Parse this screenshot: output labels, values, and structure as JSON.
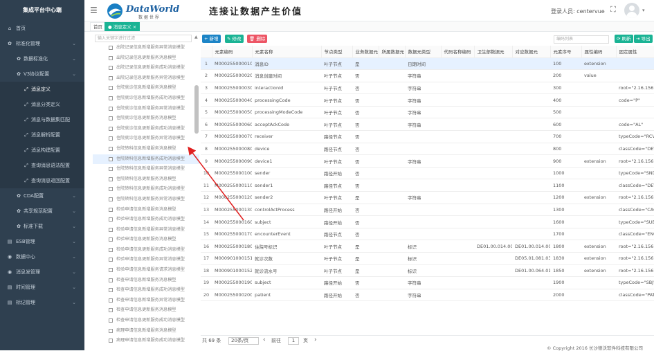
{
  "app_title": "集成平台中心端",
  "sidebar": {
    "items": [
      {
        "label": "首页",
        "icon": "home-icon",
        "glyph": "⌂",
        "level": 1,
        "arrow": ""
      },
      {
        "label": "标准化管理",
        "icon": "wrench-icon",
        "glyph": "✿",
        "level": 1,
        "arrow": "⌄"
      },
      {
        "label": "数据标准化",
        "icon": "gear-icon",
        "glyph": "✿",
        "level": 2,
        "arrow": "⌄"
      },
      {
        "label": "V3协议配置",
        "icon": "gear-icon",
        "glyph": "✿",
        "level": 2,
        "arrow": "⌄"
      },
      {
        "label": "消息定义",
        "icon": "expand-icon",
        "glyph": "⤢",
        "level": 3,
        "arrow": "",
        "active": true
      },
      {
        "label": "消息分类定义",
        "icon": "expand-icon",
        "glyph": "⤢",
        "level": 3,
        "arrow": ""
      },
      {
        "label": "消息与数据集匹配",
        "icon": "expand-icon",
        "glyph": "⤢",
        "level": 3,
        "arrow": ""
      },
      {
        "label": "消息解析配置",
        "icon": "expand-icon",
        "glyph": "⤢",
        "level": 3,
        "arrow": ""
      },
      {
        "label": "消息构建配置",
        "icon": "expand-icon",
        "glyph": "⤢",
        "level": 3,
        "arrow": ""
      },
      {
        "label": "查询消息语法配置",
        "icon": "expand-icon",
        "glyph": "⤢",
        "level": 3,
        "arrow": ""
      },
      {
        "label": "查询消息返回配置",
        "icon": "expand-icon",
        "glyph": "⤢",
        "level": 3,
        "arrow": ""
      },
      {
        "label": "CDA配置",
        "icon": "gear-icon",
        "glyph": "✿",
        "level": 2,
        "arrow": "⌄"
      },
      {
        "label": "共享规范配置",
        "icon": "gear-icon",
        "glyph": "✿",
        "level": 2,
        "arrow": "⌄"
      },
      {
        "label": "标准下载",
        "icon": "gear-icon",
        "glyph": "✿",
        "level": 2,
        "arrow": "⌄"
      },
      {
        "label": "ESB管理",
        "icon": "folder-icon",
        "glyph": "▤",
        "level": 1,
        "arrow": "⌄"
      },
      {
        "label": "数据中心",
        "icon": "globe-icon",
        "glyph": "◉",
        "level": 1,
        "arrow": "⌄"
      },
      {
        "label": "消息发管理",
        "icon": "globe-icon",
        "glyph": "◉",
        "level": 1,
        "arrow": "⌄"
      },
      {
        "label": "时间管理",
        "icon": "folder-icon",
        "glyph": "▤",
        "level": 1,
        "arrow": "⌄"
      },
      {
        "label": "标记管理",
        "icon": "folder-icon",
        "glyph": "▤",
        "level": 1,
        "arrow": "⌄"
      }
    ]
  },
  "header": {
    "logo_text": "DataWorld",
    "logo_sub": "数 据 世 界",
    "slogan": "连接让数据产生价值",
    "login_label": "登录人员:",
    "user": "centervue",
    "caret": "▾",
    "fullscreen_icon": "⛶"
  },
  "tabs": [
    {
      "label": "首页",
      "active": false
    },
    {
      "label": "● 消息定义 ×",
      "active": true
    }
  ],
  "tree": {
    "search_placeholder": "输入关键字进行过滤",
    "selected_index": 11,
    "nodes": [
      "出院记录信息新增服务异常消息模型",
      "出院记录信息更新服务消息模型",
      "出院记录信息更新服务成功消息模型",
      "出院记录信息更新服务异常消息模型",
      "住院就诊信息新增服务消息模型",
      "住院就诊信息新增服务成功消息模型",
      "住院就诊信息新增服务异常消息模型",
      "住院就诊信息更新服务消息模型",
      "住院就诊信息更新服务成功消息模型",
      "住院就诊信息更新服务异常消息模型",
      "住院转科信息新增服务消息模型",
      "住院转科信息新增服务成功消息模型",
      "住院转科信息新增服务异常消息模型",
      "住院转科信息更新服务消息模型",
      "住院转科信息更新服务成功消息模型",
      "住院转科信息更新服务异常消息模型",
      "检验申请信息新增服务消息模型",
      "检验申请信息新增服务成功消息模型",
      "检验申请信息新增服务异常消息模型",
      "检验申请信息更新服务消息模型",
      "检验申请信息更新服务成功消息模型",
      "检验申请信息更新服务异常消息模型",
      "检验申请信息新增服务请求消息模型",
      "检查申请信息新增服务消息模型",
      "检查申请信息新增服务成功消息模型",
      "检查申请信息新增服务异常消息模型",
      "检查申请信息更新服务消息模型",
      "检查申请信息更新服务成功消息模型",
      "病理申请信息新增服务消息模型",
      "病理申请信息新增服务成功消息模型"
    ]
  },
  "toolbar": {
    "add": "+ 新增",
    "edit": "✎ 修改",
    "delete": "🗑 删除",
    "search_placeholder": "编码列表",
    "refresh": "⟳ 刷新",
    "export": "⇥ 导出",
    "colors": {
      "add": "#1c84c6",
      "edit": "#1ab394",
      "delete": "#ed5565",
      "refresh": "#1ab394"
    }
  },
  "table": {
    "columns": [
      "",
      "元素编码",
      "元素名称",
      "节点类型",
      "业务数据元",
      "所属数据元",
      "数据元类型",
      "代码名称编码",
      "卫生部数据元",
      "对应数据元",
      "元素序号",
      "属性编码",
      "固定属性"
    ],
    "rows": [
      [
        "1",
        "M000255000010",
        "消息ID",
        "叶子节点",
        "是",
        "",
        "日期时间",
        "",
        "",
        "",
        "100",
        "extension",
        ""
      ],
      [
        "2",
        "M000255000020",
        "消息创建时间",
        "叶子节点",
        "否",
        "",
        "字符串",
        "",
        "",
        "",
        "200",
        "value",
        ""
      ],
      [
        "3",
        "M000255000030",
        "interactionId",
        "叶子节点",
        "否",
        "",
        "字符串",
        "",
        "",
        "",
        "300",
        "",
        "root=\"2.16.156\""
      ],
      [
        "4",
        "M000255000040",
        "processingCode",
        "叶子节点",
        "否",
        "",
        "字符串",
        "",
        "",
        "",
        "400",
        "",
        "code=\"P\""
      ],
      [
        "5",
        "M000255000050",
        "processingModeCode",
        "叶子节点",
        "否",
        "",
        "字符串",
        "",
        "",
        "",
        "500",
        "",
        ""
      ],
      [
        "6",
        "M000255000060",
        "acceptAckCode",
        "叶子节点",
        "否",
        "",
        "字符串",
        "",
        "",
        "",
        "600",
        "",
        "code=\"AL\""
      ],
      [
        "7",
        "M000255000070",
        "receiver",
        "路径节点",
        "否",
        "",
        "",
        "",
        "",
        "",
        "700",
        "",
        "typeCode=\"RCV\""
      ],
      [
        "8",
        "M000255000080",
        "device",
        "路径节点",
        "否",
        "",
        "",
        "",
        "",
        "",
        "800",
        "",
        "classCode=\"DEV\""
      ],
      [
        "9",
        "M000255000090",
        "device1",
        "叶子节点",
        "否",
        "",
        "字符串",
        "",
        "",
        "",
        "900",
        "extension",
        "root=\"2.16.156\""
      ],
      [
        "10",
        "M000255000100",
        "sender",
        "路径开始",
        "否",
        "",
        "",
        "",
        "",
        "",
        "1000",
        "",
        "typeCode=\"SND\""
      ],
      [
        "11",
        "M000255000110",
        "sender1",
        "路径节点",
        "否",
        "",
        "",
        "",
        "",
        "",
        "1100",
        "",
        "classCode=\"DEV\""
      ],
      [
        "12",
        "M000255000120",
        "sender2",
        "叶子节点",
        "是",
        "",
        "字符串",
        "",
        "",
        "",
        "1200",
        "extension",
        "root=\"2.16.156\""
      ],
      [
        "13",
        "M000255000130",
        "controlActProcess",
        "路径开始",
        "否",
        "",
        "",
        "",
        "",
        "",
        "1300",
        "",
        "classCode=\"CACT\""
      ],
      [
        "14",
        "M000255000160",
        "subject",
        "路径开始",
        "否",
        "",
        "",
        "",
        "",
        "",
        "1600",
        "",
        "typeCode=\"SUBJ\""
      ],
      [
        "15",
        "M000255000170",
        "encounterEvent",
        "路径节点",
        "否",
        "",
        "",
        "",
        "",
        "",
        "1700",
        "",
        "classCode=\"ENC\""
      ],
      [
        "16",
        "M000255000180",
        "住院号标识",
        "叶子节点",
        "是",
        "",
        "标识",
        "",
        "DE01.00.014.00",
        "DE01.00.014.00",
        "1800",
        "extension",
        "root=\"2.16.156\""
      ],
      [
        "17",
        "M000901000151",
        "就诊次数",
        "叶子节点",
        "是",
        "",
        "标识",
        "",
        "",
        "DE05.01.081.03",
        "1830",
        "extension",
        "root=\"2.16.156\""
      ],
      [
        "18",
        "M000901000152",
        "就诊流水号",
        "叶子节点",
        "是",
        "",
        "标识",
        "",
        "",
        "DE01.00.064.01",
        "1850",
        "extension",
        "root=\"2.16.156\""
      ],
      [
        "19",
        "M000255000190",
        "subject",
        "路径开始",
        "否",
        "",
        "字符串",
        "",
        "",
        "",
        "1900",
        "",
        "typeCode=\"SBJ\""
      ],
      [
        "20",
        "M000255000200",
        "patient",
        "路径开始",
        "否",
        "",
        "字符串",
        "",
        "",
        "",
        "2000",
        "",
        "classCode=\"PAT\""
      ]
    ],
    "selected_row": 0
  },
  "pager": {
    "total": "共 69 条",
    "page_size": "20条/页",
    "prev": "‹",
    "goto_label": "前往",
    "page": "1",
    "page_unit": "页",
    "next": "›"
  },
  "copyright": "© Copyright 2016 长沙德沃软件科技有限公司"
}
